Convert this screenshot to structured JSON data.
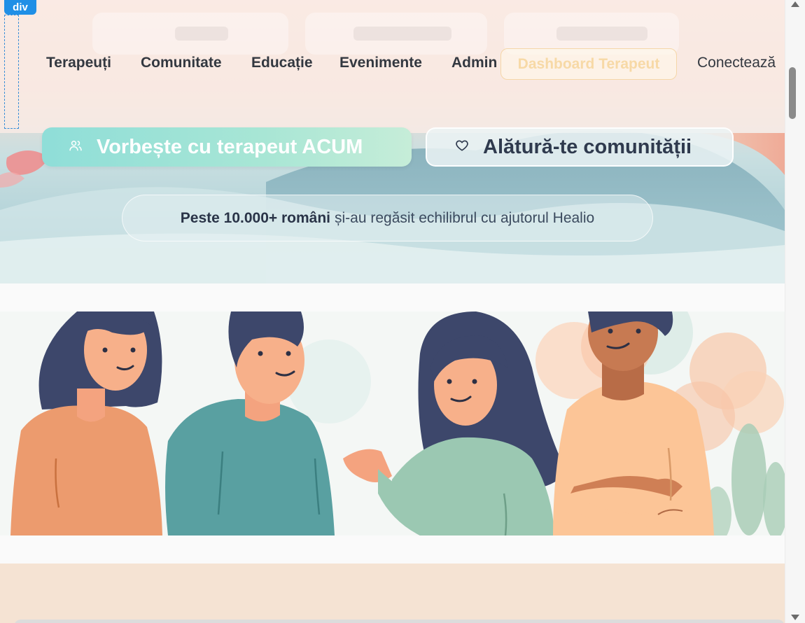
{
  "devtools": {
    "element_tag": "div"
  },
  "nav": {
    "links": [
      "Terapeuți",
      "Comunitate",
      "Educație",
      "Evenimente",
      "Admin"
    ],
    "dashboard_button": "Dashboard Terapeut",
    "connect_link": "Conectează"
  },
  "hero": {
    "primary_cta": "Vorbește cu terapeut ACUM",
    "primary_cta_icon": "users-icon",
    "secondary_cta": "Alătură-te comunității",
    "secondary_cta_icon": "heart-icon",
    "stat_bold": "Peste 10.000+ români",
    "stat_rest": "și-au regăsit echilibrul cu ajutorul Healio"
  },
  "colors": {
    "primary_cta_gradient_start": "#8fded8",
    "primary_cta_gradient_end": "#c6edd8",
    "dashboard_button_text": "#f7d9a6",
    "nav_text": "#333840",
    "section2_bg": "#f5e3d3"
  }
}
